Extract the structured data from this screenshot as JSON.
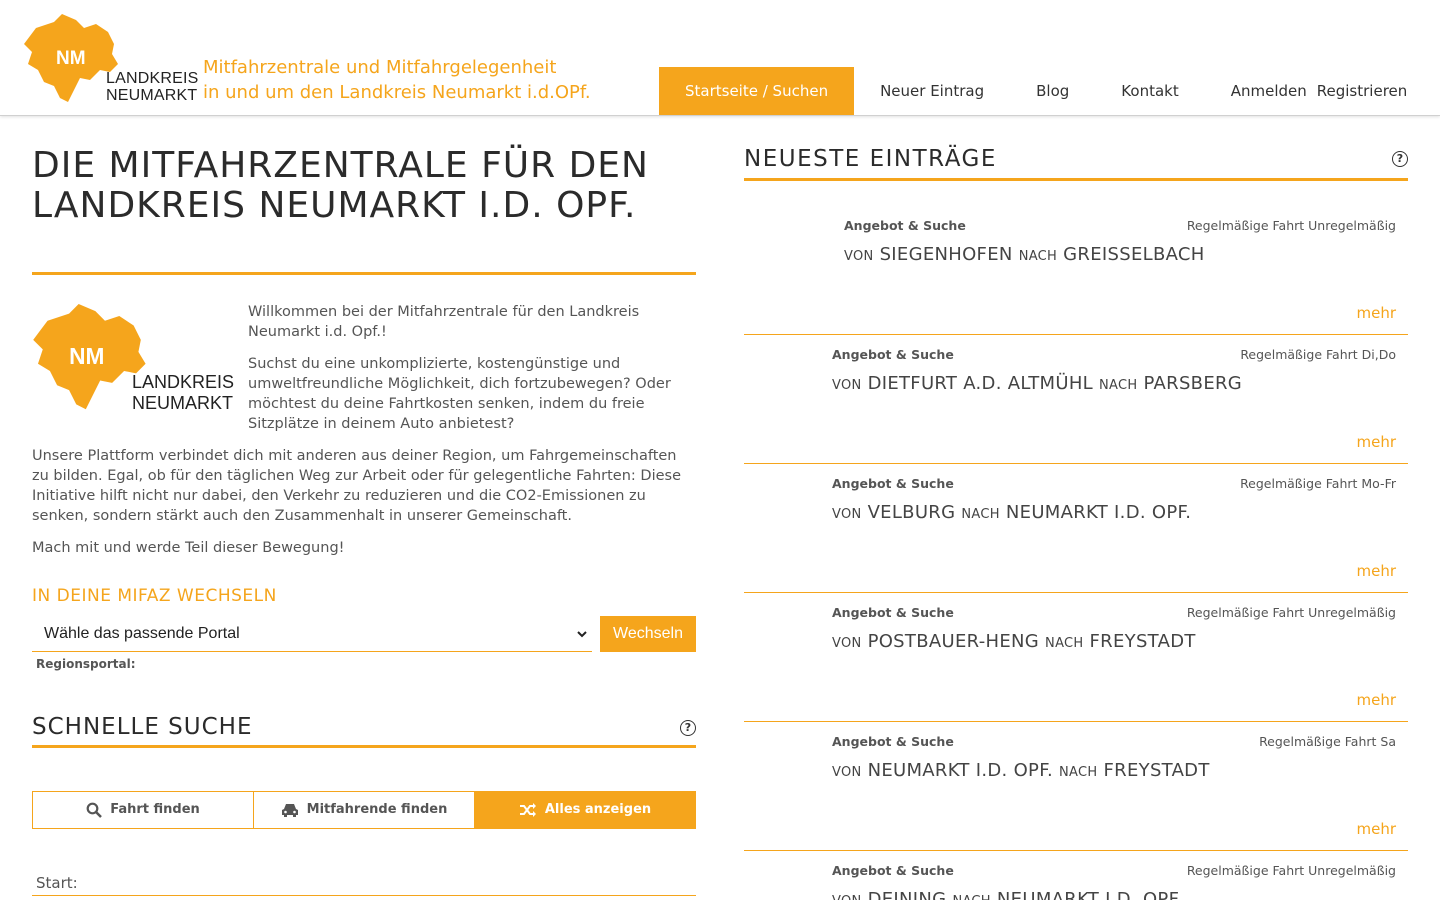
{
  "header": {
    "logo_abbr": "NM",
    "logo_line1": "LANDKREIS",
    "logo_line2": "NEUMARKT",
    "tagline_line1": "Mitfahrzentrale und Mitfahrgelegenheit",
    "tagline_line2": "in und um den Landkreis Neumarkt i.d.OPf.",
    "nav": [
      {
        "label": "Startseite / Suchen",
        "active": true
      },
      {
        "label": "Neuer Eintrag"
      },
      {
        "label": "Blog"
      },
      {
        "label": "Kontakt"
      },
      {
        "label": "Anmelden"
      },
      {
        "label": "Registrieren"
      }
    ]
  },
  "intro": {
    "title": "DIE MITFAHRZENTRALE FÜR DEN LANDKREIS NEUMARKT I.D. OPF.",
    "p1": "Willkommen bei der Mitfahrzentrale für den Landkreis Neumarkt i.d. Opf.!",
    "p2": "Suchst du eine unkomplizierte, kostengünstige und umweltfreundliche Möglichkeit, dich fortzubewegen? Oder möchtest du deine Fahrtkosten senken, indem du freie Sitzplätze in deinem Auto anbietest?",
    "p3": "Unsere Plattform verbindet dich mit anderen aus deiner Region, um Fahrgemeinschaften zu bilden. Egal, ob für den täglichen Weg zur Arbeit oder für gelegentliche Fahrten: Diese Initiative hilft nicht nur dabei, den Verkehr zu reduzieren und die CO2-Emissionen zu senken, sondern stärkt auch den Zusammenhalt in unserer Gemeinschaft.",
    "p4": "Mach mit und werde Teil dieser Bewegung!"
  },
  "mifaz": {
    "heading": "IN DEINE MIFAZ WECHSELN",
    "select_value": "Wähle das passende Portal",
    "button": "Wechseln",
    "region_label": "Regionsportal:"
  },
  "quick_search": {
    "heading": "SCHNELLE SUCHE",
    "tabs": [
      {
        "label": "Fahrt finden",
        "icon": "search-icon"
      },
      {
        "label": "Mitfahrende finden",
        "icon": "car-icon"
      },
      {
        "label": "Alles anzeigen",
        "icon": "shuffle-icon",
        "active": true
      }
    ],
    "start_label": "Start:"
  },
  "latest": {
    "heading": "NEUESTE EINTRÄGE",
    "von": "VON",
    "nach": "NACH",
    "mehr": "mehr",
    "entries": [
      {
        "kind": "Angebot & Suche",
        "freq": "Regelmäßige Fahrt Unregelmäßig",
        "from": "SIEGENHOFEN",
        "to": "GREISSELBACH"
      },
      {
        "kind": "Angebot & Suche",
        "freq": "Regelmäßige Fahrt Di,Do",
        "from": "DIETFURT A.D. ALTMÜHL",
        "to": "PARSBERG"
      },
      {
        "kind": "Angebot & Suche",
        "freq": "Regelmäßige Fahrt Mo-Fr",
        "from": "VELBURG",
        "to": "NEUMARKT I.D. OPF."
      },
      {
        "kind": "Angebot & Suche",
        "freq": "Regelmäßige Fahrt Unregelmäßig",
        "from": "POSTBAUER-HENG",
        "to": "FREYSTADT"
      },
      {
        "kind": "Angebot & Suche",
        "freq": "Regelmäßige Fahrt Sa",
        "from": "NEUMARKT I.D. OPF.",
        "to": "FREYSTADT"
      },
      {
        "kind": "Angebot & Suche",
        "freq": "Regelmäßige Fahrt Unregelmäßig",
        "from": "DEINING",
        "to": "NEUMARKT I.D. OPF."
      }
    ]
  },
  "colors": {
    "accent": "#f5a51c",
    "text": "#444444"
  }
}
